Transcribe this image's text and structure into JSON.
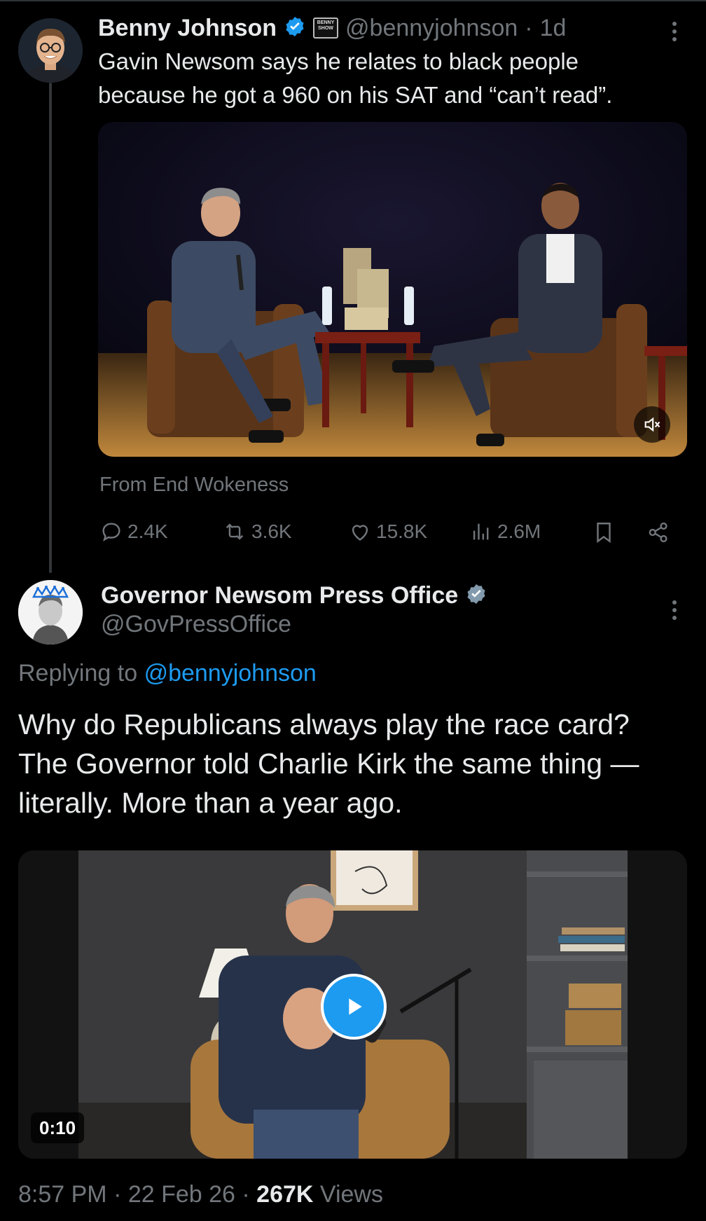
{
  "tweet1": {
    "author_name": "Benny Johnson",
    "handle": "@bennyjohnson",
    "separator": "·",
    "time_ago": "1d",
    "text_line1": "Gavin Newsom says he relates to black people",
    "text_line2": "because he got a 960 on his SAT and “can’t read”.",
    "source": "From End Wokeness",
    "stats": {
      "replies": "2.4K",
      "reposts": "3.6K",
      "likes": "15.8K",
      "views": "2.6M"
    },
    "badge_text": "BENNY SHOW"
  },
  "tweet2": {
    "author_name": "Governor Newsom Press Office",
    "handle": "@GovPressOffice",
    "replying_prefix": "Replying to",
    "replying_handle": "@bennyjohnson",
    "text_line1": "Why do Republicans always play the race card?",
    "text_line2": "The Governor told Charlie Kirk the same thing —",
    "text_line3": "literally. More than a year ago.",
    "video_duration": "0:10",
    "timestamp": "8:57 PM · 22 Feb 26 · ",
    "views_count": "267K",
    "views_label": " Views"
  },
  "colors": {
    "accent": "#1d9bf0",
    "muted": "#71767b",
    "text": "#e7e9ea",
    "background": "#000000"
  },
  "icons": [
    "verified-badge-icon",
    "more-options-icon",
    "reply-icon",
    "repost-icon",
    "like-icon",
    "views-icon",
    "bookmark-icon",
    "share-icon",
    "mute-icon",
    "play-icon"
  ]
}
